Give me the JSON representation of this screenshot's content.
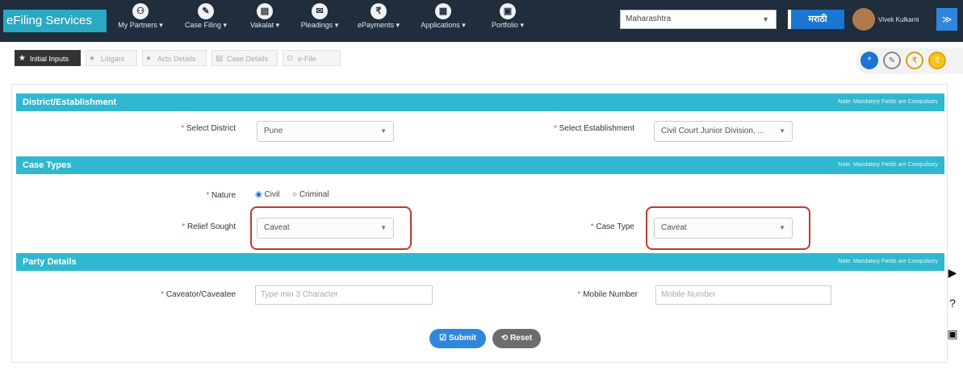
{
  "header": {
    "brand": "eFiling Services",
    "nav": [
      {
        "label": "My Partners ▾",
        "icon": "people-icon",
        "glyph": "⚇"
      },
      {
        "label": "Case Filing ▾",
        "icon": "pencil-icon",
        "glyph": "✎"
      },
      {
        "label": "Vakalat ▾",
        "icon": "document-icon",
        "glyph": "▤"
      },
      {
        "label": "Pleadings ▾",
        "icon": "mail-icon",
        "glyph": "✉"
      },
      {
        "label": "ePayments ▾",
        "icon": "rupee-icon",
        "glyph": "₹"
      },
      {
        "label": "Applications ▾",
        "icon": "file-icon",
        "glyph": "▦"
      },
      {
        "label": "Portfolio ▾",
        "icon": "briefcase-icon",
        "glyph": "▣"
      }
    ],
    "state_select": "Maharashtra",
    "language_button": "मराठी",
    "user_name": "Vivek Kulkarni",
    "collapse_glyph": "≫"
  },
  "steps": [
    {
      "label": "Initial Inputs",
      "icon": "star-icon",
      "glyph": "★"
    },
    {
      "label": "Litigant",
      "icon": "user-icon",
      "glyph": "👤"
    },
    {
      "label": "Acts Details",
      "icon": "user-icon",
      "glyph": "👤"
    },
    {
      "label": "Case Details",
      "icon": "file-icon",
      "glyph": "▤"
    },
    {
      "label": "e-File",
      "icon": "upload-icon",
      "glyph": "⊙"
    }
  ],
  "sections": {
    "district": {
      "title": "District/Establishment",
      "note": "Note: Mandatory Fields are Compulsory",
      "district_label": "Select District",
      "district_value": "Pune",
      "establishment_label": "Select Establishment",
      "establishment_value": "Civil Court Junior Division, ..."
    },
    "case_types": {
      "title": "Case Types",
      "note": "Note: Mandatory Fields are Compulsory",
      "nature_label": "Nature",
      "nature_options": [
        "Civil",
        "Criminal"
      ],
      "nature_selected": "Civil",
      "relief_label": "Relief Sought",
      "relief_value": "Caveat",
      "case_type_label": "Case Type",
      "case_type_value": "Caveat"
    },
    "party": {
      "title": "Party Details",
      "note": "Note: Mandatory Fields are Compulsory",
      "caveator_label": "Caveator/Caveatee",
      "caveator_placeholder": "Type min 3 Character",
      "mobile_label": "Mobile Number",
      "mobile_placeholder": "Mobile Number"
    }
  },
  "actions": {
    "submit": "Submit",
    "reset": "Reset"
  },
  "colors": {
    "topbar": "#1f2d3d",
    "section_header": "#2fb8cf",
    "highlight": "#c0392b",
    "submit": "#2e86de",
    "reset": "#6c6c6c"
  }
}
